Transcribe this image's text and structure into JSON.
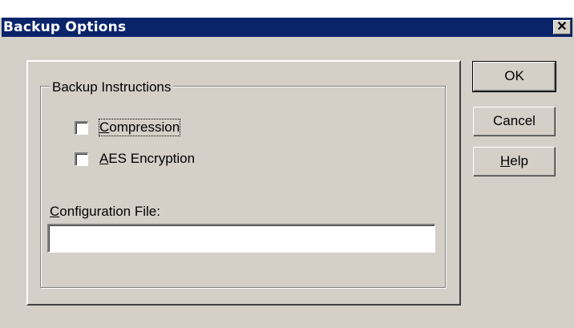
{
  "window": {
    "title": "Backup Options",
    "close_glyph": "✕"
  },
  "group": {
    "label": "Backup Instructions"
  },
  "options": [
    {
      "label_first": "C",
      "label_rest": "ompression",
      "checked": false
    },
    {
      "label_first": "A",
      "label_rest": "ES Encryption",
      "checked": false
    }
  ],
  "config": {
    "label_first": "C",
    "label_rest": "onfiguration File:",
    "value": ""
  },
  "buttons": {
    "ok": "OK",
    "cancel": "Cancel",
    "help_first": "H",
    "help_rest": "elp"
  }
}
